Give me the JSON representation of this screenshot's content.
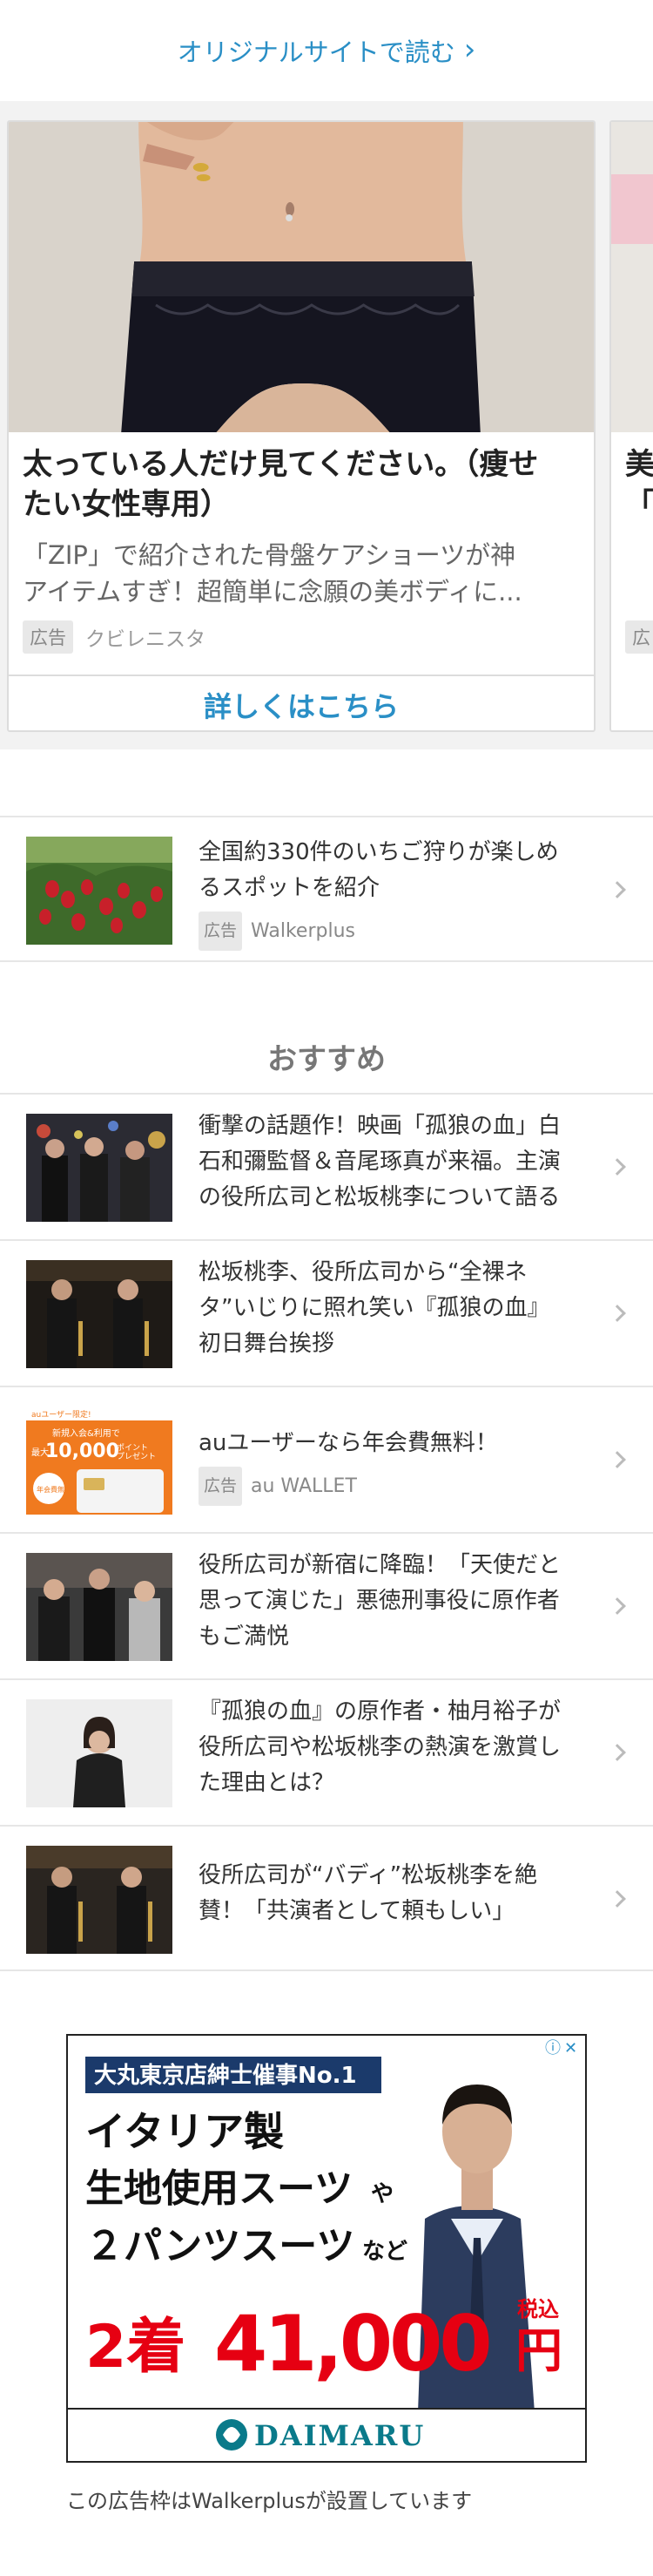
{
  "top_link": {
    "label": "オリジナルサイトで読む",
    "chevron": "chevron-right-icon"
  },
  "carousel": {
    "card1": {
      "title_lines": [
        "太っている人だけ見てください。（痩せ",
        "たい女性専用）"
      ],
      "desc_lines": [
        "「ZIP」で紹介された骨盤ケアショーツが神",
        "アイテムすぎ！超簡単に念願の美ボディに..."
      ],
      "badge": "広告",
      "sponsor": "クビレニスタ",
      "cta": "詳しくはこちら"
    },
    "card2": {
      "title_lines": [
        "美",
        "「"
      ],
      "badge": "広"
    }
  },
  "promo": {
    "lines": [
      "全国約330件のいちご狩りが楽しめ",
      "るスポットを紹介"
    ],
    "badge": "広告",
    "sponsor": "Walkerplus"
  },
  "recommended": {
    "title": "おすすめ",
    "items": [
      {
        "lines": [
          "衝撃の話題作！映画「孤狼の血」白",
          "石和彌監督＆音尾琢真が来福。主演",
          "の役所広司と松坂桃李について語る"
        ]
      },
      {
        "lines": [
          "松坂桃李、役所広司から“全裸ネ",
          "タ”いじりに照れ笑い『孤狼の血』",
          "初日舞台挨拶"
        ]
      },
      {
        "lines": [
          "auユーザーなら年会費無料！"
        ],
        "badge": "広告",
        "sponsor": "au WALLET"
      },
      {
        "lines": [
          "役所広司が新宿に降臨！「天使だと",
          "思って演じた」悪徳刑事役に原作者",
          "もご満悦"
        ]
      },
      {
        "lines": [
          "『孤狼の血』の原作者・柚月裕子が",
          "役所広司や松坂桃李の熱演を激賞し",
          "た理由とは？"
        ]
      },
      {
        "lines": [
          "役所広司が“バディ”松坂桃李を絶",
          "賛！「共演者として頼もしい」"
        ]
      }
    ]
  },
  "thumb_card_text": {
    "small": "auユーザー限定!",
    "campaign": "新規入会&利用で",
    "amount_prefix": "最大",
    "amount": "10,000",
    "unit": "ポイント",
    "present": "プレゼント",
    "fee": "年会費無料"
  },
  "ad_banner": {
    "headline": "大丸東京店紳士催事No.1",
    "line1": "イタリア製",
    "line2a": "生地使用スーツ",
    "line2b": "や",
    "line3a": "２パンツスーツ",
    "line3b": "など",
    "price_prefix": "2着",
    "price": "41,000",
    "price_suffix": "円",
    "tax": "税込",
    "brand": "DAIMARU",
    "info_icon": "info-icon",
    "close_icon": "close-icon"
  },
  "ad_caption": "この広告枠はWalkerplusが設置しています",
  "colors": {
    "accent": "#2a8fc6",
    "ad_red": "#e60012",
    "ad_navy": "#1b3a6b"
  }
}
